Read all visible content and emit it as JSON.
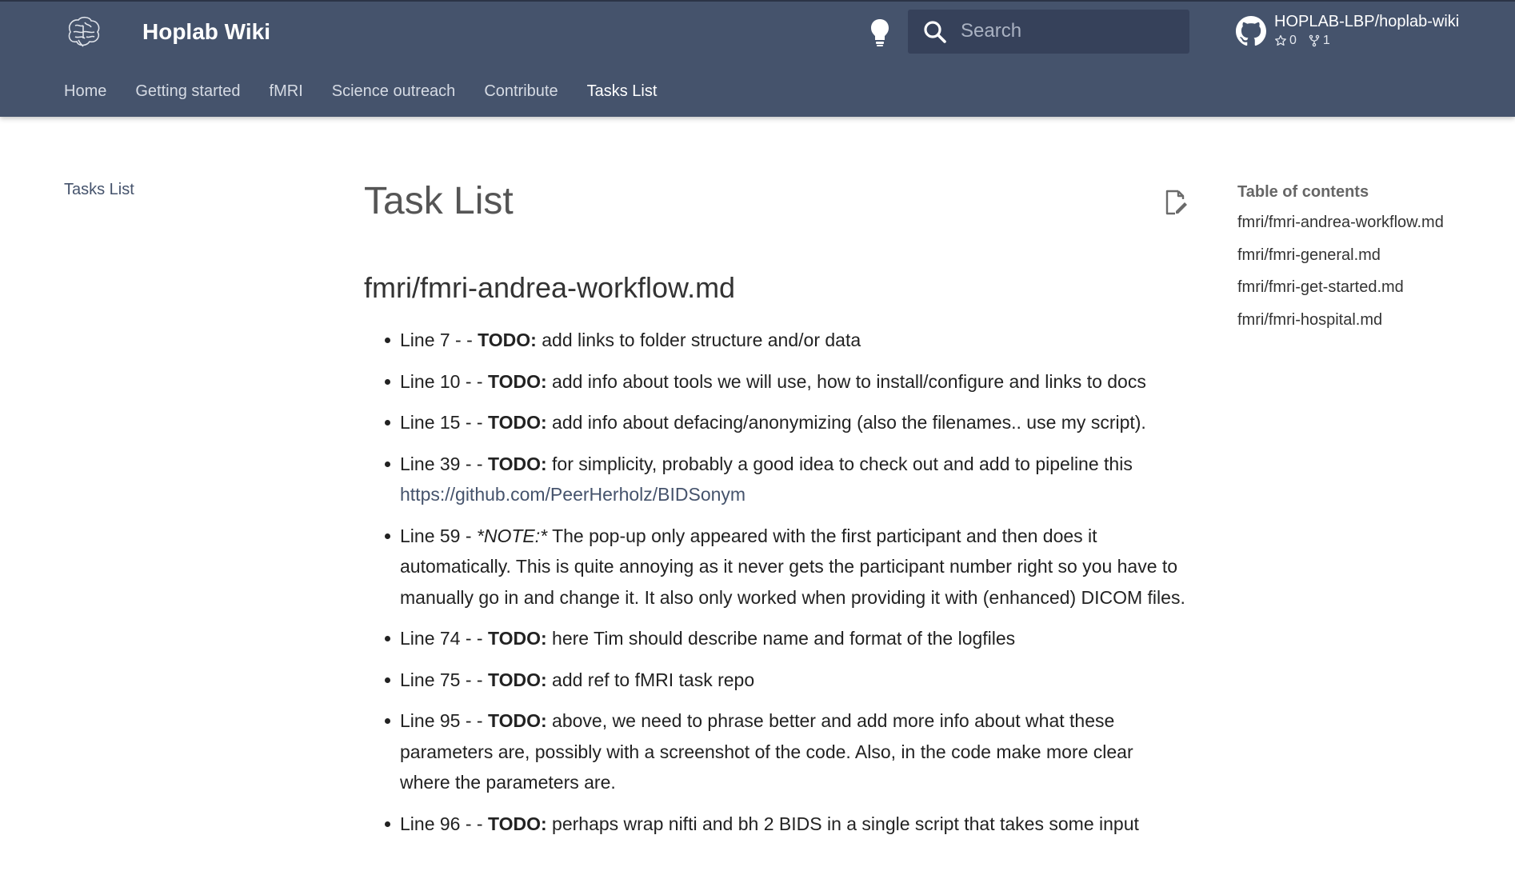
{
  "header": {
    "site_title": "Hoplab Wiki",
    "logo_icon": "brain-icon",
    "search_placeholder": "Search",
    "repo": {
      "name": "HOPLAB-LBP/hoplab-wiki",
      "stars": "0",
      "forks": "1"
    }
  },
  "nav": {
    "tabs": [
      {
        "label": "Home"
      },
      {
        "label": "Getting started"
      },
      {
        "label": "fMRI"
      },
      {
        "label": "Science outreach"
      },
      {
        "label": "Contribute"
      },
      {
        "label": "Tasks List",
        "active": true
      }
    ]
  },
  "sidebar": {
    "items": [
      {
        "label": "Tasks List"
      }
    ]
  },
  "main": {
    "title": "Task List",
    "section_heading": "fmri/fmri-andrea-workflow.md",
    "items": [
      {
        "prefix": "Line 7 - - ",
        "tag": "TODO:",
        "text": " add links to folder structure and/or data"
      },
      {
        "prefix": "Line 10 - - ",
        "tag": "TODO:",
        "text": " add info about tools we will use, how to install/configure and links to docs"
      },
      {
        "prefix": "Line 15 - - ",
        "tag": "TODO:",
        "text": " add info about defacing/anonymizing (also the filenames.. use my script)."
      },
      {
        "prefix": "Line 39 - - ",
        "tag": "TODO:",
        "text": " for simplicity, probably a good idea to check out and add to pipeline this ",
        "link": "https://github.com/PeerHerholz/BIDSonym"
      },
      {
        "prefix": "Line 59 - ",
        "note": "*NOTE:*",
        "text": " The pop-up only appeared with the first participant and then does it automatically. This is quite annoying as it never gets the participant number right so you have to manually go in and change it. It also only worked when providing it with (enhanced) DICOM files."
      },
      {
        "prefix": "Line 74 - - ",
        "tag": "TODO:",
        "text": " here Tim should describe name and format of the logfiles"
      },
      {
        "prefix": "Line 75 - - ",
        "tag": "TODO:",
        "text": " add ref to fMRI task repo"
      },
      {
        "prefix": "Line 95 - - ",
        "tag": "TODO:",
        "text": " above, we need to phrase better and add more info about what these parameters are, possibly with a screenshot of the code. Also, in the code make more clear where the parameters are."
      },
      {
        "prefix": "Line 96 - - ",
        "tag": "TODO:",
        "text": " perhaps wrap nifti and bh 2 BIDS in a single script that takes some input"
      }
    ]
  },
  "toc": {
    "title": "Table of contents",
    "items": [
      {
        "label": "fmri/fmri-andrea-workflow.md"
      },
      {
        "label": "fmri/fmri-general.md"
      },
      {
        "label": "fmri/fmri-get-started.md"
      },
      {
        "label": "fmri/fmri-hospital.md"
      }
    ]
  },
  "colors": {
    "header_bg": "#45536c",
    "search_bg": "#36415a",
    "link": "#45536c"
  }
}
